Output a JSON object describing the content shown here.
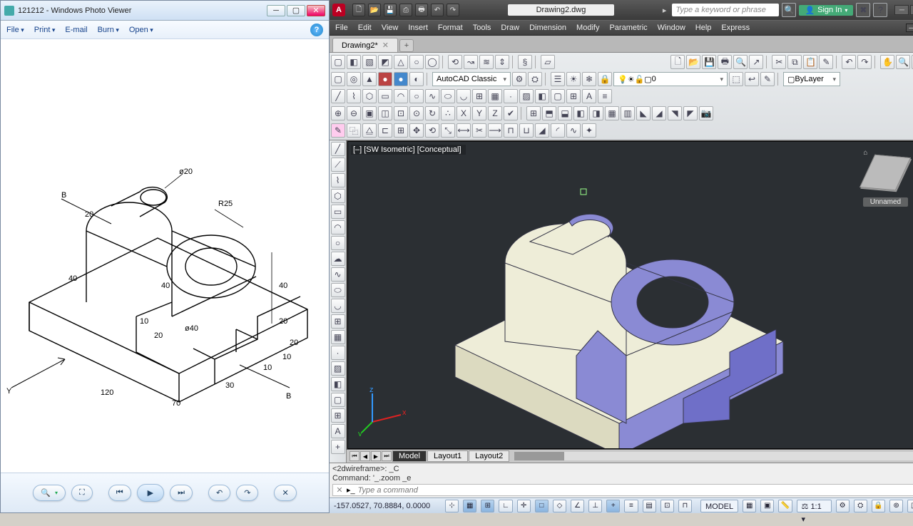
{
  "wpv": {
    "title": "121212 - Windows Photo Viewer",
    "menu": {
      "file": "File",
      "print": "Print",
      "email": "E-mail",
      "burn": "Burn",
      "open": "Open"
    },
    "dims": {
      "d1": "ø20",
      "d2": "20",
      "d3": "40",
      "d4": "R25",
      "d5": "40",
      "d6": "40",
      "d7": "10",
      "d8": "20",
      "d9": "ø40",
      "d10": "20",
      "d11": "20",
      "d12": "10",
      "d13": "10",
      "d14": "30",
      "d15": "70",
      "d16": "120",
      "b1": "B",
      "b2": "B",
      "y": "Y"
    }
  },
  "acad": {
    "doc": "Drawing2.dwg",
    "search_ph": "Type a keyword or phrase",
    "signin": "Sign In",
    "menu": [
      "File",
      "Edit",
      "View",
      "Insert",
      "Format",
      "Tools",
      "Draw",
      "Dimension",
      "Modify",
      "Parametric",
      "Window",
      "Help",
      "Express"
    ],
    "tab": "Drawing2*",
    "ws_select": "AutoCAD Classic",
    "layer_select": "0",
    "bylayer": "ByLayer",
    "vp_label": {
      "a": "[–]",
      "b": "[SW Isometric]",
      "c": "[Conceptual]"
    },
    "viewcube": "Unnamed",
    "layouts": {
      "model": "Model",
      "l1": "Layout1",
      "l2": "Layout2"
    },
    "cmd_hist": [
      "<2dwireframe>: _C",
      "Command: '_.zoom _e"
    ],
    "cmd_prompt": "Type a command",
    "coords": "-157.0527, 70.8884, 0.0000",
    "status_model": "MODEL",
    "status_scale": "1:1"
  }
}
